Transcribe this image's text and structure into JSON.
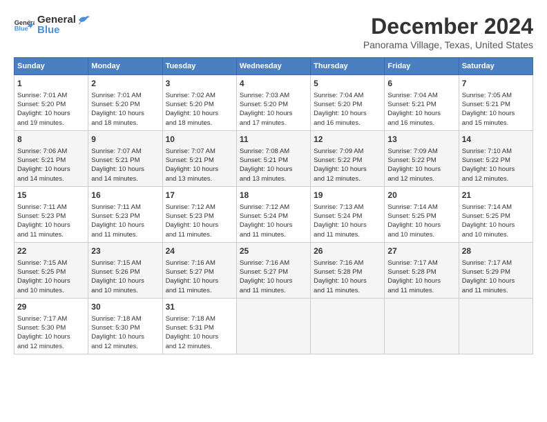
{
  "app": {
    "name_general": "General",
    "name_blue": "Blue"
  },
  "title": "December 2024",
  "subtitle": "Panorama Village, Texas, United States",
  "days_of_week": [
    "Sunday",
    "Monday",
    "Tuesday",
    "Wednesday",
    "Thursday",
    "Friday",
    "Saturday"
  ],
  "weeks": [
    [
      {
        "day": "1",
        "sunrise": "7:01 AM",
        "sunset": "5:20 PM",
        "daylight": "10 hours and 19 minutes."
      },
      {
        "day": "2",
        "sunrise": "7:01 AM",
        "sunset": "5:20 PM",
        "daylight": "10 hours and 18 minutes."
      },
      {
        "day": "3",
        "sunrise": "7:02 AM",
        "sunset": "5:20 PM",
        "daylight": "10 hours and 18 minutes."
      },
      {
        "day": "4",
        "sunrise": "7:03 AM",
        "sunset": "5:20 PM",
        "daylight": "10 hours and 17 minutes."
      },
      {
        "day": "5",
        "sunrise": "7:04 AM",
        "sunset": "5:20 PM",
        "daylight": "10 hours and 16 minutes."
      },
      {
        "day": "6",
        "sunrise": "7:04 AM",
        "sunset": "5:21 PM",
        "daylight": "10 hours and 16 minutes."
      },
      {
        "day": "7",
        "sunrise": "7:05 AM",
        "sunset": "5:21 PM",
        "daylight": "10 hours and 15 minutes."
      }
    ],
    [
      {
        "day": "8",
        "sunrise": "7:06 AM",
        "sunset": "5:21 PM",
        "daylight": "10 hours and 14 minutes."
      },
      {
        "day": "9",
        "sunrise": "7:07 AM",
        "sunset": "5:21 PM",
        "daylight": "10 hours and 14 minutes."
      },
      {
        "day": "10",
        "sunrise": "7:07 AM",
        "sunset": "5:21 PM",
        "daylight": "10 hours and 13 minutes."
      },
      {
        "day": "11",
        "sunrise": "7:08 AM",
        "sunset": "5:21 PM",
        "daylight": "10 hours and 13 minutes."
      },
      {
        "day": "12",
        "sunrise": "7:09 AM",
        "sunset": "5:22 PM",
        "daylight": "10 hours and 12 minutes."
      },
      {
        "day": "13",
        "sunrise": "7:09 AM",
        "sunset": "5:22 PM",
        "daylight": "10 hours and 12 minutes."
      },
      {
        "day": "14",
        "sunrise": "7:10 AM",
        "sunset": "5:22 PM",
        "daylight": "10 hours and 12 minutes."
      }
    ],
    [
      {
        "day": "15",
        "sunrise": "7:11 AM",
        "sunset": "5:23 PM",
        "daylight": "10 hours and 11 minutes."
      },
      {
        "day": "16",
        "sunrise": "7:11 AM",
        "sunset": "5:23 PM",
        "daylight": "10 hours and 11 minutes."
      },
      {
        "day": "17",
        "sunrise": "7:12 AM",
        "sunset": "5:23 PM",
        "daylight": "10 hours and 11 minutes."
      },
      {
        "day": "18",
        "sunrise": "7:12 AM",
        "sunset": "5:24 PM",
        "daylight": "10 hours and 11 minutes."
      },
      {
        "day": "19",
        "sunrise": "7:13 AM",
        "sunset": "5:24 PM",
        "daylight": "10 hours and 11 minutes."
      },
      {
        "day": "20",
        "sunrise": "7:14 AM",
        "sunset": "5:25 PM",
        "daylight": "10 hours and 10 minutes."
      },
      {
        "day": "21",
        "sunrise": "7:14 AM",
        "sunset": "5:25 PM",
        "daylight": "10 hours and 10 minutes."
      }
    ],
    [
      {
        "day": "22",
        "sunrise": "7:15 AM",
        "sunset": "5:25 PM",
        "daylight": "10 hours and 10 minutes."
      },
      {
        "day": "23",
        "sunrise": "7:15 AM",
        "sunset": "5:26 PM",
        "daylight": "10 hours and 10 minutes."
      },
      {
        "day": "24",
        "sunrise": "7:16 AM",
        "sunset": "5:27 PM",
        "daylight": "10 hours and 11 minutes."
      },
      {
        "day": "25",
        "sunrise": "7:16 AM",
        "sunset": "5:27 PM",
        "daylight": "10 hours and 11 minutes."
      },
      {
        "day": "26",
        "sunrise": "7:16 AM",
        "sunset": "5:28 PM",
        "daylight": "10 hours and 11 minutes."
      },
      {
        "day": "27",
        "sunrise": "7:17 AM",
        "sunset": "5:28 PM",
        "daylight": "10 hours and 11 minutes."
      },
      {
        "day": "28",
        "sunrise": "7:17 AM",
        "sunset": "5:29 PM",
        "daylight": "10 hours and 11 minutes."
      }
    ],
    [
      {
        "day": "29",
        "sunrise": "7:17 AM",
        "sunset": "5:30 PM",
        "daylight": "10 hours and 12 minutes."
      },
      {
        "day": "30",
        "sunrise": "7:18 AM",
        "sunset": "5:30 PM",
        "daylight": "10 hours and 12 minutes."
      },
      {
        "day": "31",
        "sunrise": "7:18 AM",
        "sunset": "5:31 PM",
        "daylight": "10 hours and 12 minutes."
      },
      null,
      null,
      null,
      null
    ]
  ],
  "labels": {
    "sunrise": "Sunrise:",
    "sunset": "Sunset:",
    "daylight": "Daylight:"
  }
}
